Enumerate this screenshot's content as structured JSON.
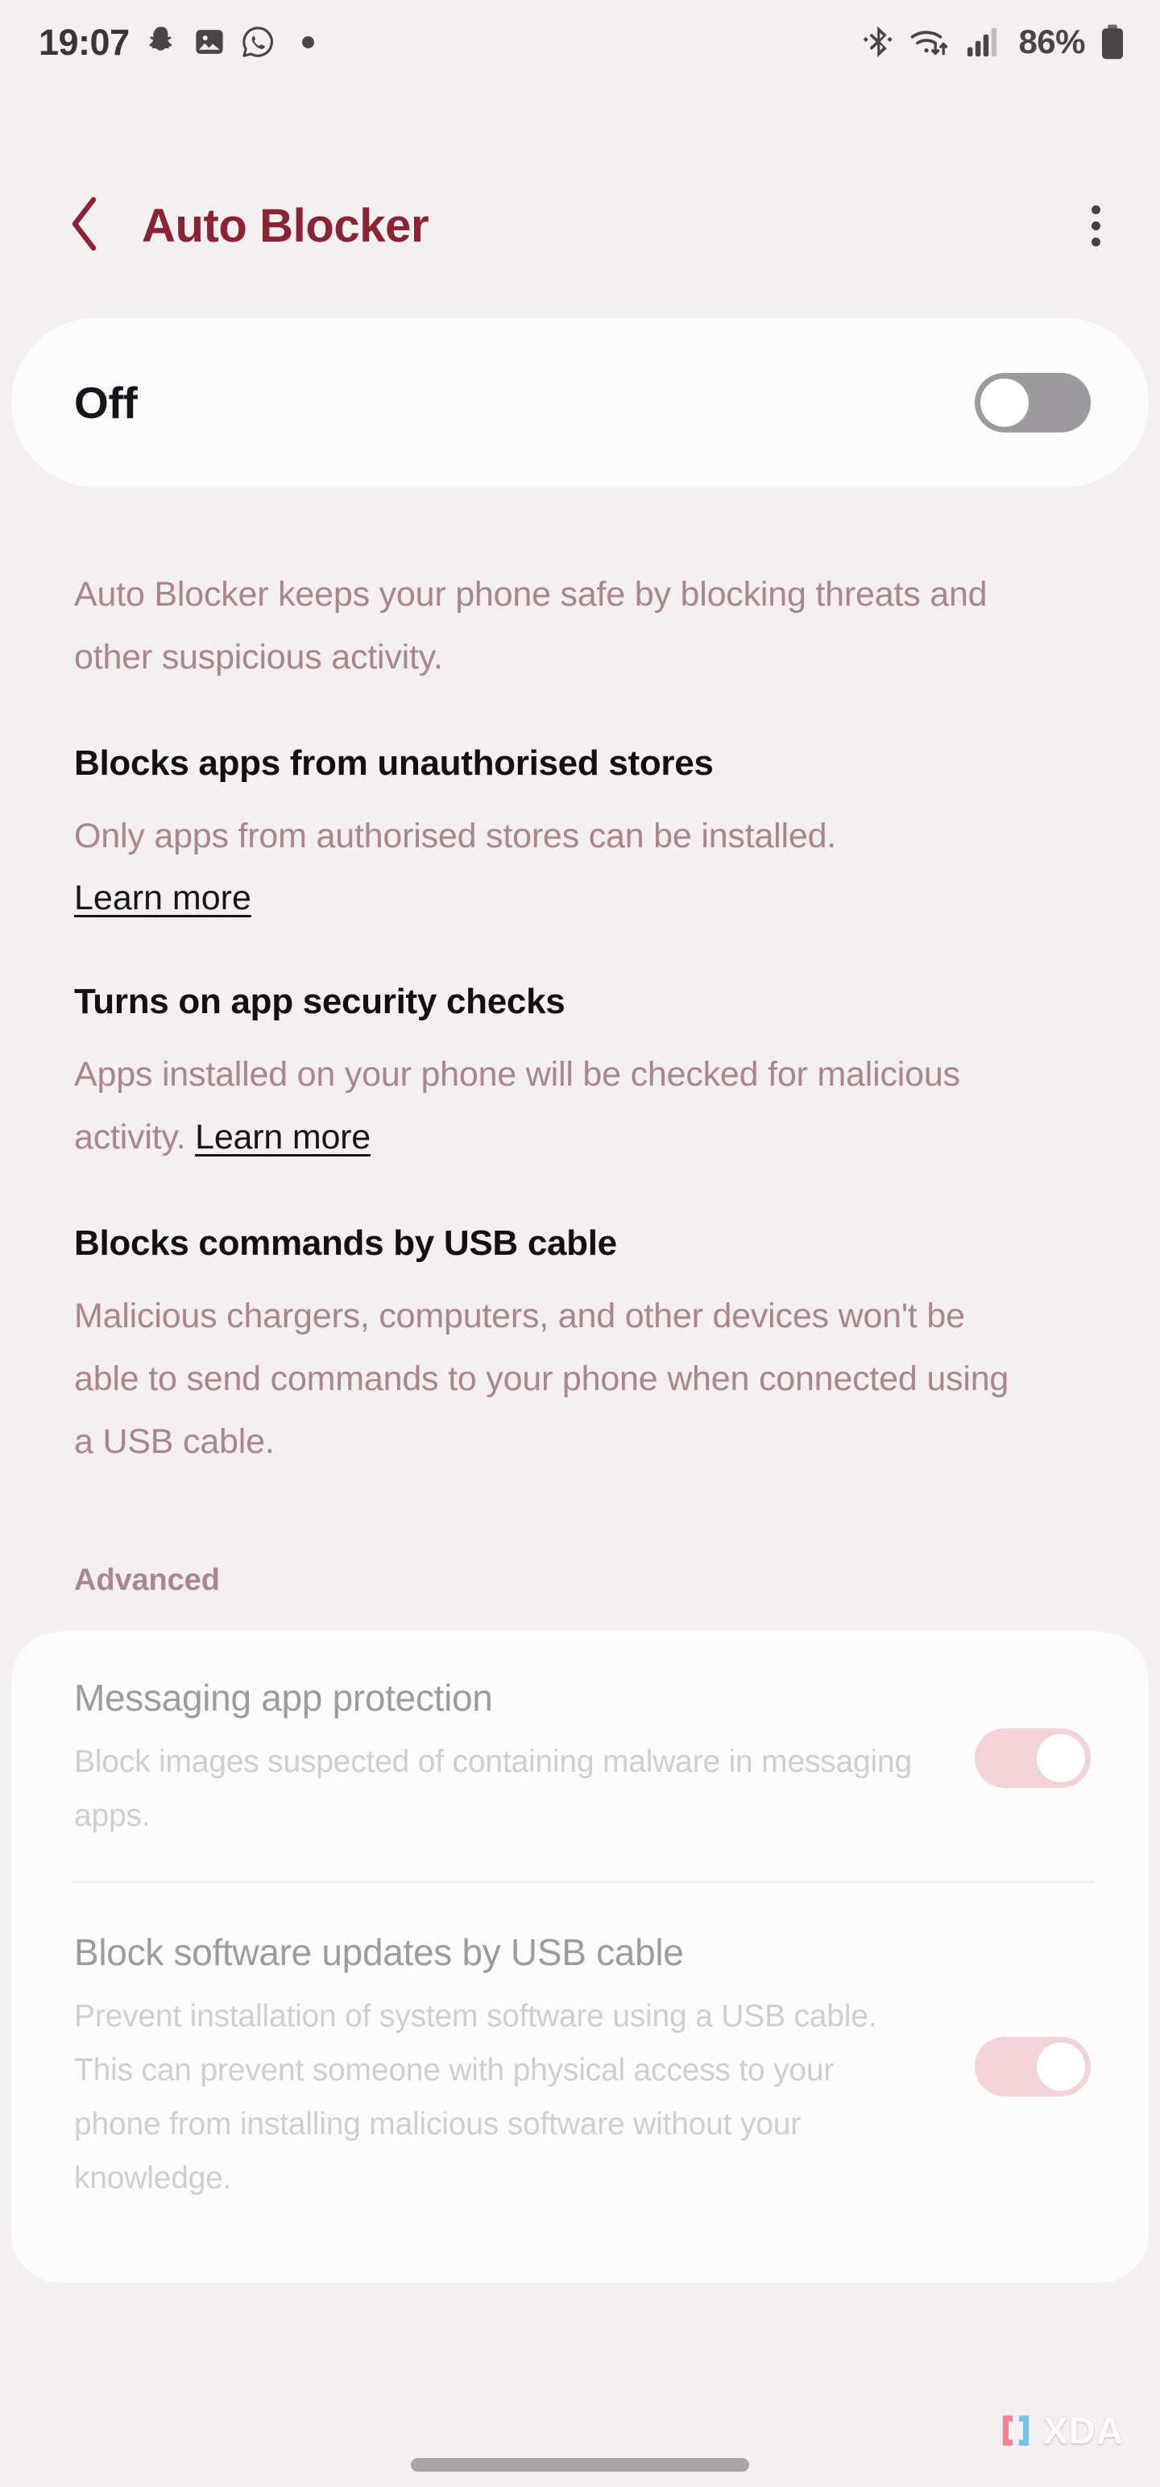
{
  "status_bar": {
    "clock": "19:07",
    "battery_percent": "86%",
    "left_icons": [
      "snapchat-icon",
      "gallery-icon",
      "whatsapp-icon",
      "notification-dot-icon"
    ],
    "right_icons": [
      "bluetooth-icon",
      "wifi-icon",
      "cellular-signal-icon",
      "battery-icon"
    ]
  },
  "header": {
    "title": "Auto Blocker",
    "back_icon": "chevron-left-icon",
    "overflow_icon": "more-vertical-icon"
  },
  "master": {
    "label": "Off",
    "state": "off"
  },
  "intro": "Auto Blocker keeps your phone safe by blocking threats and other suspicious activity.",
  "features": [
    {
      "title": "Blocks apps from unauthorised stores",
      "desc": "Only apps from authorised stores can be installed.",
      "link": "Learn more",
      "link_inline": false
    },
    {
      "title": "Turns on app security checks",
      "desc": "Apps installed on your phone will be checked for malicious activity.",
      "link": "Learn more",
      "link_inline": true
    },
    {
      "title": "Blocks commands by USB cable",
      "desc": "Malicious chargers, computers, and other devices won't be able to send commands to your phone when connected using a USB cable.",
      "link": "",
      "link_inline": false
    }
  ],
  "advanced": {
    "header": "Advanced",
    "rows": [
      {
        "title": "Messaging app protection",
        "desc": "Block images suspected of containing malware in messaging apps.",
        "state": "on-disabled"
      },
      {
        "title": "Block software updates by USB cable",
        "desc": "Prevent installation of system software using a USB cable. This can prevent someone with physical access to your phone from installing malicious software without your knowledge.",
        "state": "on-disabled"
      }
    ]
  },
  "watermark": {
    "text": "XDA",
    "icon": "xda-bracket-logo"
  },
  "colors": {
    "background": "#F4EFF0",
    "card": "#FDFCFC",
    "title_accent": "#8A2333",
    "body_mauve": "#A8868C",
    "heading_dark": "#131013",
    "switch_off_track": "#9C9A9F",
    "switch_on_disabled_track": "#F2D3D8",
    "disabled_title": "#9D9BA0",
    "disabled_desc": "#CFCDD1"
  }
}
